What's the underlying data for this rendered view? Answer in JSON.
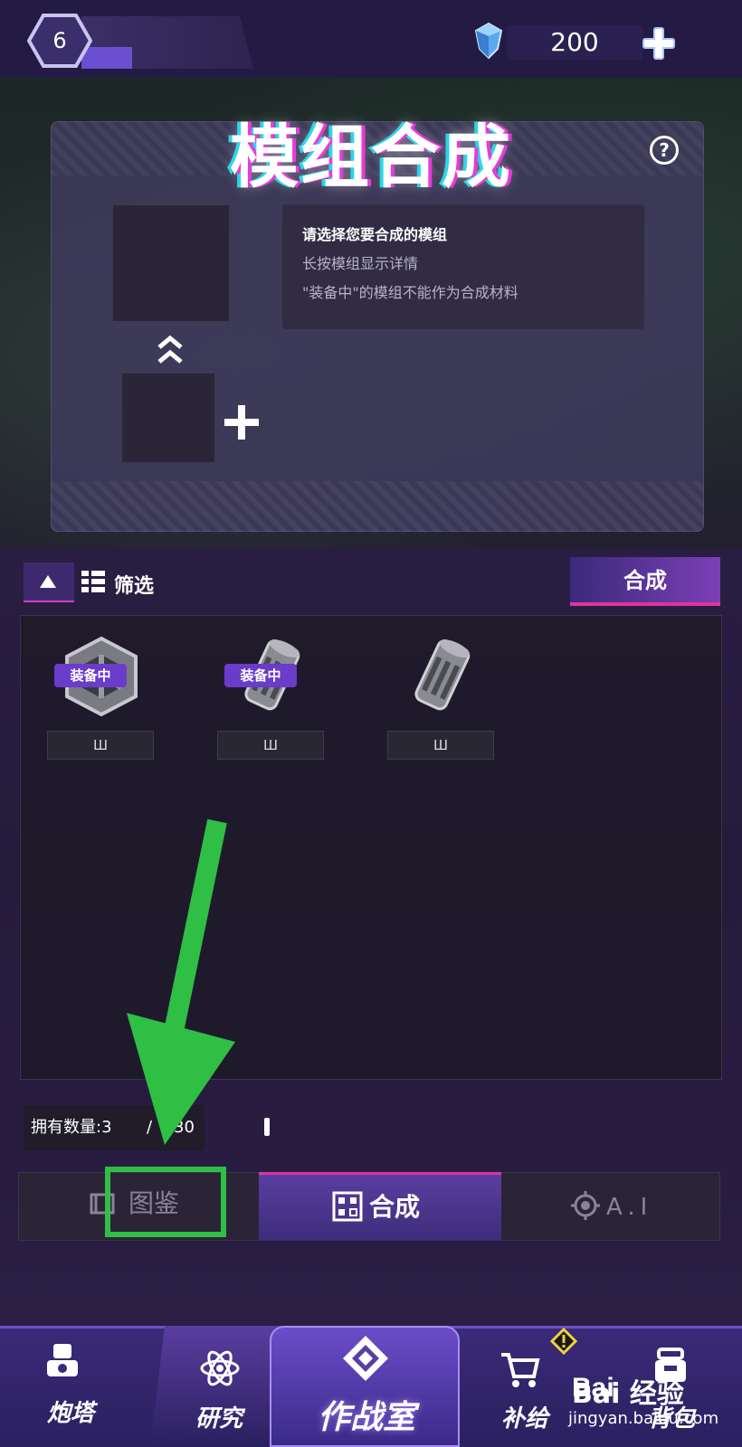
{
  "header": {
    "level": "6",
    "gems": "200"
  },
  "panel": {
    "title": "模组合成",
    "help_symbol": "?",
    "info_line1": "请选择您要合成的模组",
    "info_line2": "长按模组显示详情",
    "info_line3": "\"装备中\"的模组不能作为合成材料"
  },
  "filter": {
    "label": "筛选",
    "synth_button": "合成"
  },
  "modules": [
    {
      "icon": "frame-module-icon",
      "badge": "装备中",
      "level": "Ш"
    },
    {
      "icon": "cylinder-module-icon",
      "badge": "装备中",
      "level": "Ш"
    },
    {
      "icon": "cylinder-module-icon",
      "badge": "",
      "level": "Ш"
    }
  ],
  "owned": {
    "label": "拥有数量:3",
    "slash": "/",
    "total": "30"
  },
  "subtabs": {
    "atlas": "图鉴",
    "synth": "合成",
    "ai": "A.I"
  },
  "nav": {
    "turret": "炮塔",
    "research": "研究",
    "war_room": "作战室",
    "supply": "补给",
    "backpack": "背包"
  },
  "watermark": {
    "brand": "Bai 经验",
    "url": "jingyan.baidu.com"
  },
  "colors": {
    "accent_purple": "#6b4fd1",
    "accent_pink": "#e0339e",
    "annotation_green": "#2fbf44"
  }
}
